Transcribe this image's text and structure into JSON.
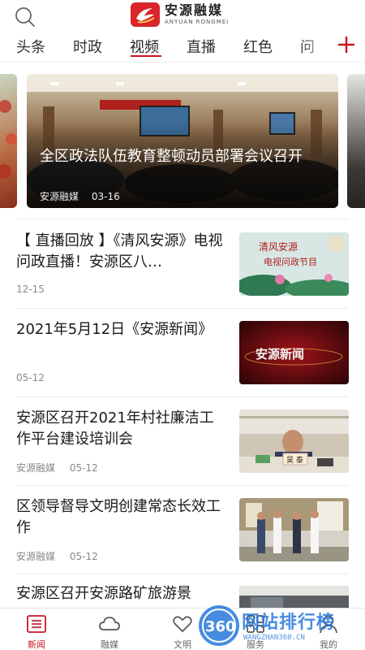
{
  "header": {
    "logo_cn": "安源融媒",
    "logo_en": "ANYUAN RONGMEI"
  },
  "tabs": [
    {
      "label": "头条"
    },
    {
      "label": "时政"
    },
    {
      "label": "视频",
      "active": true
    },
    {
      "label": "直播"
    },
    {
      "label": "红色"
    },
    {
      "label": "问"
    }
  ],
  "carousel": {
    "title": "全区政法队伍教育整顿动员部署会议召开",
    "source": "安源融媒",
    "date": "03-16"
  },
  "news": [
    {
      "title": "【 直播回放 】《清风安源》电视问政直播！安源区八…",
      "source": "",
      "date": "12-15",
      "thumb_text": [
        "清风安源",
        "电视问政节目"
      ]
    },
    {
      "title": "2021年5月12日《安源新闻》",
      "source": "",
      "date": "05-12",
      "thumb_text": [
        "安源新闻"
      ]
    },
    {
      "title": "安源区召开2021年村社廉洁工作平台建设培训会",
      "source": "安源融媒",
      "date": "05-12",
      "thumb_text": [
        "吴 泰"
      ]
    },
    {
      "title": "区领导督导文明创建常态长效工作",
      "source": "安源融媒",
      "date": "05-12",
      "thumb_text": []
    },
    {
      "title": "安源区召开安源路矿旅游景",
      "source": "",
      "date": "",
      "thumb_text": []
    }
  ],
  "bottom_nav": [
    {
      "label": "新闻",
      "icon": "news-icon",
      "active": true
    },
    {
      "label": "融媒",
      "icon": "cloud-icon"
    },
    {
      "label": "文明",
      "icon": "heart-icon"
    },
    {
      "label": "服务",
      "icon": "grid-icon"
    },
    {
      "label": "我的",
      "icon": "user-icon"
    }
  ],
  "watermark": {
    "text": "网站排行榜",
    "sub": "WANGZHAN360.CN",
    "badge": "360"
  },
  "colors": {
    "accent": "#c8161d",
    "logo_red": "#d8262b",
    "watermark_blue": "#2878dc"
  }
}
